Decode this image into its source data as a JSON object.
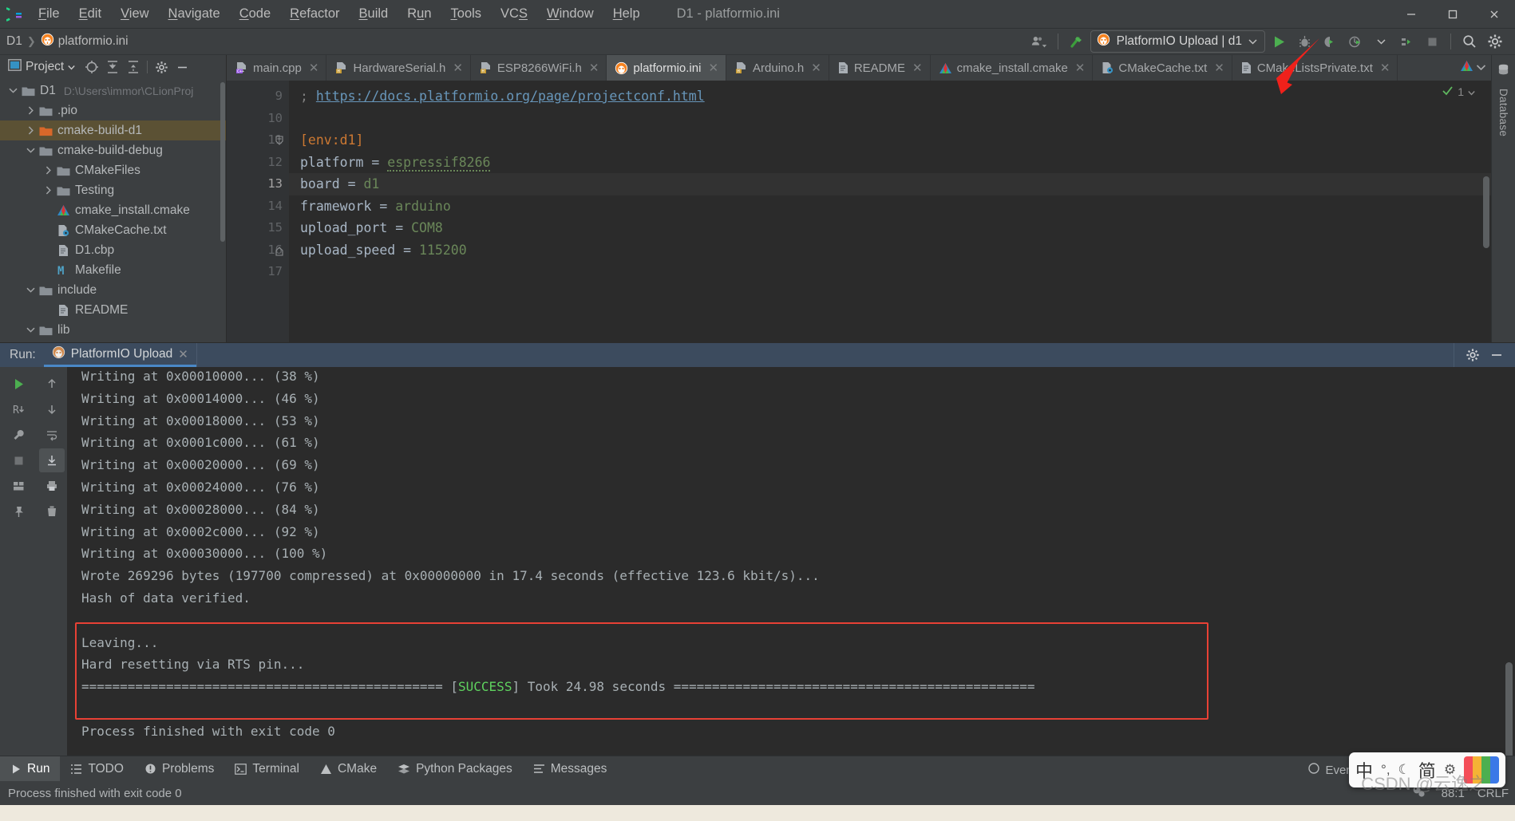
{
  "window": {
    "title": "D1 - platformio.ini",
    "controls": [
      "minimize",
      "maximize",
      "close"
    ]
  },
  "menubar": {
    "items": [
      {
        "label": "File",
        "mnemonic": "F"
      },
      {
        "label": "Edit",
        "mnemonic": "E"
      },
      {
        "label": "View",
        "mnemonic": "V"
      },
      {
        "label": "Navigate",
        "mnemonic": "N"
      },
      {
        "label": "Code",
        "mnemonic": "C"
      },
      {
        "label": "Refactor",
        "mnemonic": "R"
      },
      {
        "label": "Build",
        "mnemonic": "B"
      },
      {
        "label": "Run",
        "mnemonic": "u"
      },
      {
        "label": "Tools",
        "mnemonic": "T"
      },
      {
        "label": "VCS",
        "mnemonic": "S"
      },
      {
        "label": "Window",
        "mnemonic": "W"
      },
      {
        "label": "Help",
        "mnemonic": "H"
      }
    ]
  },
  "navbar": {
    "breadcrumbs": [
      "D1",
      "platformio.ini"
    ],
    "run_config": "PlatformIO Upload | d1",
    "icons": [
      "user-dropdown-icon",
      "hammer-build-icon",
      "run-icon",
      "debug-icon",
      "run-coverage-icon",
      "profile-icon",
      "attach-process-icon",
      "stop-icon",
      "search-icon",
      "settings-gear-icon"
    ]
  },
  "project_panel": {
    "title": "Project",
    "header_icons": [
      "project-view-icon",
      "scope-target-icon",
      "expand-all-icon",
      "collapse-all-icon",
      "gear-icon",
      "hide-icon"
    ],
    "tree": [
      {
        "label": "D1",
        "path": "D:\\Users\\immor\\CLionProj",
        "depth": 0,
        "state": "expanded",
        "icon": "folder",
        "selected": false
      },
      {
        "label": ".pio",
        "path": "",
        "depth": 1,
        "state": "collapsed",
        "icon": "folder",
        "selected": false
      },
      {
        "label": "cmake-build-d1",
        "path": "",
        "depth": 1,
        "state": "collapsed",
        "icon": "folder-orange",
        "selected": true
      },
      {
        "label": "cmake-build-debug",
        "path": "",
        "depth": 1,
        "state": "expanded",
        "icon": "folder",
        "selected": false
      },
      {
        "label": "CMakeFiles",
        "path": "",
        "depth": 2,
        "state": "collapsed",
        "icon": "folder",
        "selected": false
      },
      {
        "label": "Testing",
        "path": "",
        "depth": 2,
        "state": "collapsed",
        "icon": "folder",
        "selected": false
      },
      {
        "label": "cmake_install.cmake",
        "path": "",
        "depth": 2,
        "state": "leaf",
        "icon": "cmake",
        "selected": false
      },
      {
        "label": "CMakeCache.txt",
        "path": "",
        "depth": 2,
        "state": "leaf",
        "icon": "cmakecache",
        "selected": false
      },
      {
        "label": "D1.cbp",
        "path": "",
        "depth": 2,
        "state": "leaf",
        "icon": "file",
        "selected": false
      },
      {
        "label": "Makefile",
        "path": "",
        "depth": 2,
        "state": "leaf",
        "icon": "makefile",
        "selected": false
      },
      {
        "label": "include",
        "path": "",
        "depth": 1,
        "state": "expanded",
        "icon": "folder",
        "selected": false
      },
      {
        "label": "README",
        "path": "",
        "depth": 2,
        "state": "leaf",
        "icon": "file",
        "selected": false
      },
      {
        "label": "lib",
        "path": "",
        "depth": 1,
        "state": "expanded",
        "icon": "folder",
        "selected": false
      }
    ]
  },
  "editor": {
    "tabs": [
      {
        "label": "main.cpp",
        "icon": "cpp-file-icon",
        "active": false,
        "closable": true
      },
      {
        "label": "HardwareSerial.h",
        "icon": "header-file-icon",
        "active": false,
        "closable": true
      },
      {
        "label": "ESP8266WiFi.h",
        "icon": "header-file-icon",
        "active": false,
        "closable": true
      },
      {
        "label": "platformio.ini",
        "icon": "platformio-icon",
        "active": true,
        "closable": true
      },
      {
        "label": "Arduino.h",
        "icon": "header-file-icon",
        "active": false,
        "closable": true
      },
      {
        "label": "README",
        "icon": "file-icon",
        "active": false,
        "closable": true
      },
      {
        "label": "cmake_install.cmake",
        "icon": "cmake-icon",
        "active": false,
        "closable": true
      },
      {
        "label": "CMakeCache.txt",
        "icon": "cmakecache-icon",
        "active": false,
        "closable": true
      },
      {
        "label": "CMakeListsPrivate.txt",
        "icon": "file-icon",
        "active": false,
        "closable": true
      }
    ],
    "tabs_overflow_icons": [
      "cmake-icon",
      "chevron-down-icon"
    ],
    "inspection": {
      "count": "1",
      "status_icon": "checkmark-icon"
    },
    "first_line_number": 9,
    "current_line": 13,
    "lines": [
      {
        "n": 9,
        "text": "; https://docs.platformio.org/page/projectconf.html",
        "type": "comment_link",
        "comment": ";",
        "link": "https://docs.platformio.org/page/projectconf.html"
      },
      {
        "n": 10,
        "text": "",
        "type": "blank"
      },
      {
        "n": 11,
        "text": "[env:d1]",
        "type": "section",
        "fold": "start"
      },
      {
        "n": 12,
        "text": "platform = espressif8266",
        "type": "kv",
        "key": "platform",
        "value": "espressif8266",
        "spellcheck": true
      },
      {
        "n": 13,
        "text": "board = d1",
        "type": "kv",
        "key": "board",
        "value": "d1"
      },
      {
        "n": 14,
        "text": "framework = arduino",
        "type": "kv",
        "key": "framework",
        "value": "arduino"
      },
      {
        "n": 15,
        "text": "upload_port = COM8",
        "type": "kv",
        "key": "upload_port",
        "value": "COM8"
      },
      {
        "n": 16,
        "text": "upload_speed = 115200",
        "type": "kv",
        "key": "upload_speed",
        "value": "115200",
        "fold": "end"
      },
      {
        "n": 17,
        "text": "",
        "type": "blank"
      }
    ]
  },
  "right_rail": {
    "label": "Database",
    "icon": "database-icon"
  },
  "run_window": {
    "label": "Run:",
    "tab": "PlatformIO Upload",
    "tab_icon": "platformio-icon",
    "header_icons": [
      "settings-gear-icon",
      "hide-icon"
    ],
    "rail_icons": [
      "rerun-icon",
      "scroll-up-icon",
      "rerun-failed-icon",
      "scroll-down-icon",
      "wrench-icon",
      "soft-wrap-icon",
      "stop-icon",
      "scroll-to-end-icon",
      "print-icon",
      "grid-icon",
      "trash-icon",
      "pin-icon"
    ],
    "console_lines": [
      {
        "text": "Writing at 0x00010000... (38 %)",
        "clipped": true
      },
      {
        "text": "Writing at 0x00014000... (46 %)"
      },
      {
        "text": "Writing at 0x00018000... (53 %)"
      },
      {
        "text": "Writing at 0x0001c000... (61 %)"
      },
      {
        "text": "Writing at 0x00020000... (69 %)"
      },
      {
        "text": "Writing at 0x00024000... (76 %)"
      },
      {
        "text": "Writing at 0x00028000... (84 %)"
      },
      {
        "text": "Writing at 0x0002c000... (92 %)"
      },
      {
        "text": "Writing at 0x00030000... (100 %)"
      },
      {
        "text": "Wrote 269296 bytes (197700 compressed) at 0x00000000 in 17.4 seconds (effective 123.6 kbit/s)..."
      },
      {
        "text": "Hash of data verified."
      },
      {
        "text": ""
      },
      {
        "text": "Leaving...",
        "highlighted": true
      },
      {
        "text": "Hard resetting via RTS pin...",
        "highlighted": true
      },
      {
        "pre": "=============================================== [",
        "status": "SUCCESS",
        "post": "] Took 24.98 seconds ===============================================",
        "highlighted": true
      },
      {
        "text": ""
      },
      {
        "text": "Process finished with exit code 0"
      }
    ]
  },
  "bottom_tool_buttons": [
    {
      "label": "Run",
      "icon": "run-icon",
      "active": true
    },
    {
      "label": "TODO",
      "icon": "todo-icon",
      "active": false
    },
    {
      "label": "Problems",
      "icon": "problems-icon",
      "active": false
    },
    {
      "label": "Terminal",
      "icon": "terminal-icon",
      "active": false
    },
    {
      "label": "CMake",
      "icon": "cmake-icon",
      "active": false
    },
    {
      "label": "Python Packages",
      "icon": "python-packages-icon",
      "active": false
    },
    {
      "label": "Messages",
      "icon": "messages-icon",
      "active": false
    }
  ],
  "statusbar": {
    "message": "Process finished with exit code 0",
    "caret": "88:1",
    "line_separator": "CRLF",
    "event_log": "Event Log",
    "icons": [
      "python-interpreter-icon",
      "event-log-icon"
    ]
  },
  "ime": {
    "mode": "中",
    "simplified": "简",
    "icons": [
      "punctuation-icon",
      "moon-icon",
      "gear-icon"
    ]
  },
  "watermark": "CSDN @云逸之",
  "annotations": [
    {
      "type": "red-arrow",
      "target": "run-button"
    },
    {
      "type": "red-rectangle",
      "target": "success-output-block"
    }
  ],
  "colors": {
    "accent_blue": "#4a88c7",
    "success_green": "#5fd35f",
    "annotation_red": "#e84135",
    "selection_brown": "#5b5134",
    "panel_bg": "#3c3f41",
    "editor_bg": "#2b2b2b"
  }
}
